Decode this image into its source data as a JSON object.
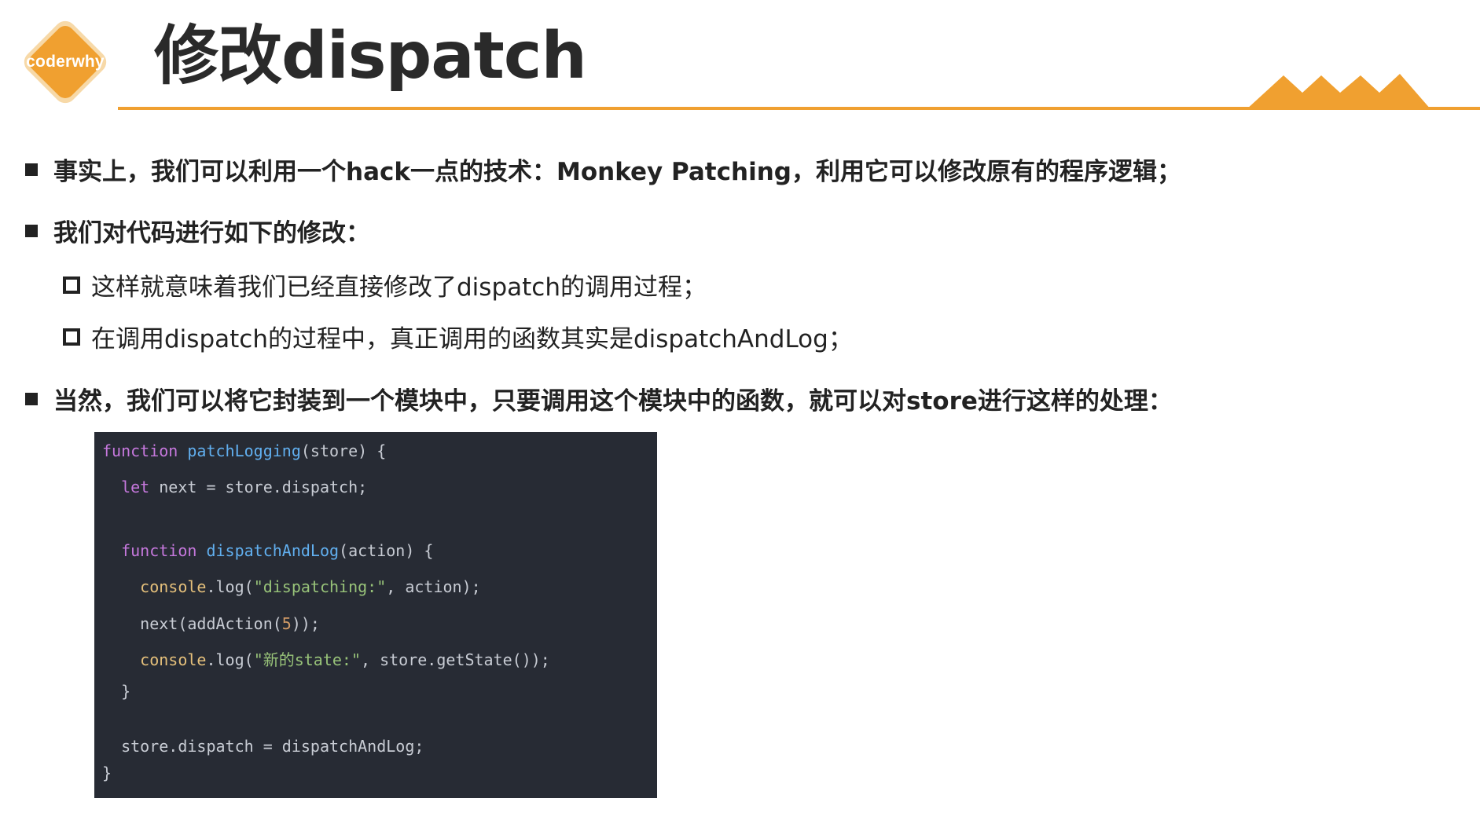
{
  "header": {
    "logo_text": "coderwhy",
    "title": "修改dispatch"
  },
  "colors": {
    "accent": "#f0a030",
    "code_bg": "#272b34"
  },
  "bullets": [
    {
      "text": "事实上，我们可以利用一个hack一点的技术：Monkey Patching，利用它可以修改原有的程序逻辑；"
    },
    {
      "text": "我们对代码进行如下的修改："
    },
    {
      "text": "当然，我们可以将它封装到一个模块中，只要调用这个模块中的函数，就可以对store进行这样的处理："
    }
  ],
  "sub_bullets": [
    {
      "text": "这样就意味着我们已经直接修改了dispatch的调用过程；"
    },
    {
      "text": "在调用dispatch的过程中，真正调用的函数其实是dispatchAndLog；"
    }
  ],
  "code": {
    "l1": {
      "kw": "function",
      "fn": "patchLogging",
      "rest": "(store) {"
    },
    "l2": {
      "kw": "let",
      "rest": " next = store.dispatch;"
    },
    "l3": {
      "kw": "function",
      "fn": "dispatchAndLog",
      "rest": "(action) {"
    },
    "l4": {
      "obj": "console",
      "mid": ".log(",
      "str": "\"dispatching:\"",
      "rest": ", action);"
    },
    "l5": {
      "pre": "next(addAction(",
      "num": "5",
      "rest": "));"
    },
    "l6": {
      "obj": "console",
      "mid": ".log(",
      "str": "\"新的state:\"",
      "rest": ", store.getState());"
    },
    "l7": {
      "text": "}"
    },
    "l8": {
      "text": "store.dispatch = dispatchAndLog;"
    },
    "l9": {
      "text": "}"
    }
  }
}
